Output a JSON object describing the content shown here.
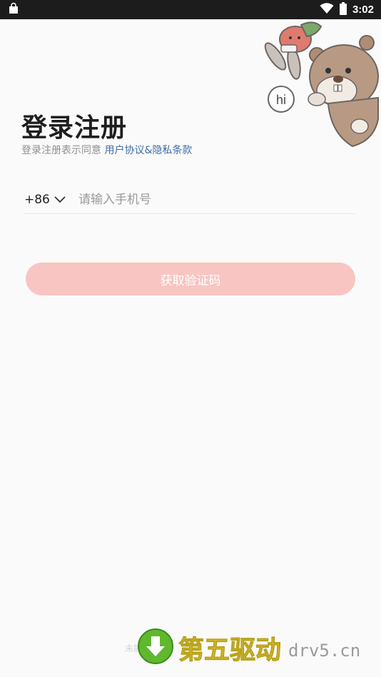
{
  "status_bar": {
    "time": "3:02"
  },
  "header": {
    "title": "登录注册",
    "subtitle_prefix": "登录注册表示同意 ",
    "agreement_link": "用户协议&隐私条款"
  },
  "mascot": {
    "speech_bubble": "hi"
  },
  "form": {
    "country_code": "+86",
    "phone_placeholder": "请输入手机号",
    "phone_value": "",
    "submit_label": "获取验证码"
  },
  "footer": {
    "text": "未能"
  },
  "watermark": {
    "brand": "第五驱动",
    "domain": "drv5.cn"
  },
  "colors": {
    "button_bg": "#f8c5c2",
    "link": "#3d6ea5",
    "title": "#1e1e1e"
  }
}
